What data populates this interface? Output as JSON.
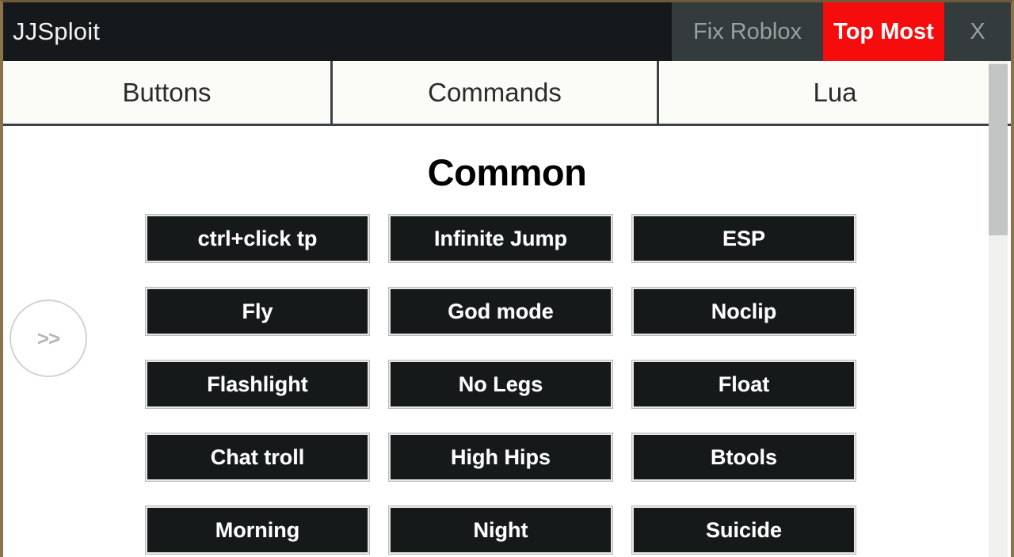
{
  "window": {
    "title": "JJSploit",
    "titlebar_buttons": [
      {
        "label": "Fix Roblox",
        "name": "fix-roblox-button"
      },
      {
        "label": "Top Most",
        "name": "top-most-button"
      },
      {
        "label": "X",
        "name": "close-button"
      }
    ],
    "accent_red": "#f60c0c",
    "titlebar_bg": "#15191b",
    "frame_border": "#8a7249"
  },
  "tabs": [
    {
      "label": "Buttons"
    },
    {
      "label": "Commands"
    },
    {
      "label": "Lua"
    }
  ],
  "main": {
    "section_title": "Common",
    "expand_handle_label": ">>",
    "buttons": [
      "ctrl+click tp",
      "Infinite Jump",
      "ESP",
      "Fly",
      "God mode",
      "Noclip",
      "Flashlight",
      "No Legs",
      "Float",
      "Chat troll",
      "High Hips",
      "Btools",
      "Morning",
      "Night",
      "Suicide"
    ]
  }
}
